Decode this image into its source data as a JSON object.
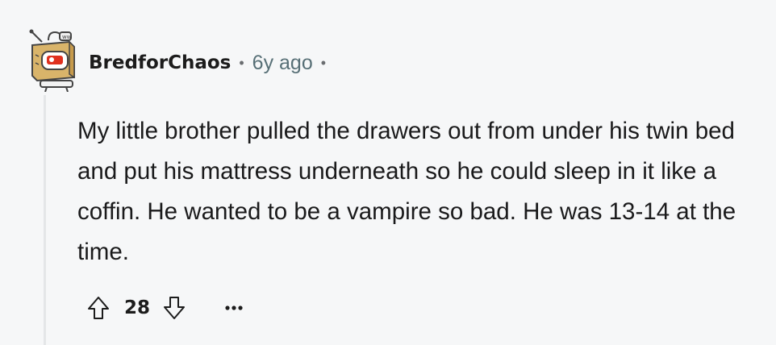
{
  "comment": {
    "author": "BredforChaos",
    "separator": "•",
    "age": "6y ago",
    "trailing_separator": "•",
    "body": "My little brother pulled the drawers out from under his twin bed and put his mattress underneath so he could sleep in it like a coffin. He wanted to be a vampire so bad. He was 13-14 at the time.",
    "score": "28",
    "more_label": "•••"
  },
  "icons": {
    "avatar": "avatar-robot-icon",
    "upvote": "arrow-up-icon",
    "downvote": "arrow-down-icon",
    "more": "more-options-icon"
  },
  "colors": {
    "background": "#f6f7f8",
    "text": "#1a1a1b",
    "meta": "#576f76",
    "thread_line": "#e4e6e8",
    "accent_red": "#e0301e"
  }
}
